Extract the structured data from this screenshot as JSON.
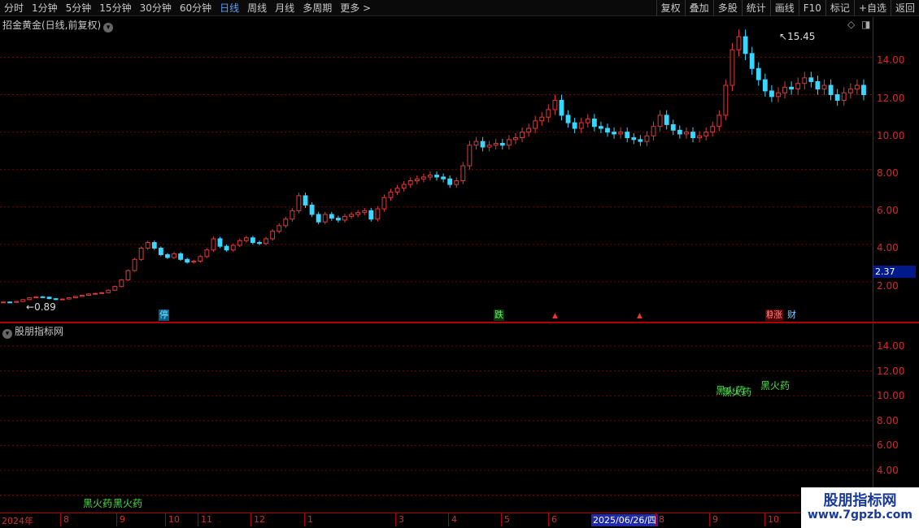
{
  "toolbar": {
    "periods": [
      "分时",
      "1分钟",
      "5分钟",
      "15分钟",
      "30分钟",
      "60分钟",
      "日线",
      "周线",
      "月线",
      "多周期",
      "更多"
    ],
    "active_period": "日线",
    "right_buttons": [
      "复权",
      "叠加",
      "多股",
      "统计",
      "画线",
      "F10",
      "标记",
      "+自选",
      "返回"
    ]
  },
  "main": {
    "title": "招金黄金(日线,前复权)",
    "title_icon": "chevron-down-icon",
    "corner_icons": [
      "diamond-icon",
      "panel-toggle-icon"
    ],
    "y_labels": [
      "14.00",
      "12.00",
      "10.00",
      "8.00",
      "6.00",
      "4.00",
      "2.00"
    ],
    "current_price_tag": "2.37",
    "high_label": "15.45",
    "low_label": "0.89",
    "badges": [
      {
        "text": "停",
        "style": "blue"
      },
      {
        "text": "跌",
        "style": "green"
      },
      {
        "text": "糕",
        "style": "red"
      },
      {
        "text": "涨",
        "style": "red"
      },
      {
        "text": "财",
        "style": "plain"
      }
    ]
  },
  "sub": {
    "title": "股朋指标网",
    "title_icon": "chevron-down-icon",
    "y_labels": [
      "14.00",
      "12.00",
      "10.00",
      "8.00",
      "6.00",
      "4.00"
    ],
    "notes": [
      "黑火药",
      "黑火药",
      "黑火药",
      "黑火药",
      "黑火药"
    ]
  },
  "timeline": {
    "labels": [
      "2024年",
      "8",
      "9",
      "10",
      "11",
      "12",
      "1",
      "3",
      "4",
      "5",
      "6",
      "8",
      "9",
      "10"
    ],
    "cursor_date": "2025/06/26/四"
  },
  "watermark": {
    "line1": "股朋指标网",
    "line2": "www.7gpzb.com"
  },
  "colors": {
    "up": "#e03a3a",
    "down": "#3ad6ff",
    "grid": "#7a0000",
    "axis": "#b00000",
    "note": "#4ce04c",
    "active": "#5aa0ff"
  },
  "chart_data": {
    "type": "candlestick",
    "title": "招金黄金(日线,前复权)",
    "ylim": [
      0,
      15.8
    ],
    "x_range": [
      "2024年",
      "2025/10"
    ],
    "close_series": [
      0.92,
      0.9,
      0.95,
      1.05,
      1.15,
      1.2,
      1.18,
      1.1,
      1.05,
      1.08,
      1.15,
      1.22,
      1.28,
      1.35,
      1.38,
      1.42,
      1.55,
      1.75,
      2.1,
      2.6,
      3.2,
      3.8,
      4.1,
      3.8,
      3.45,
      3.3,
      3.5,
      3.2,
      3.05,
      3.1,
      3.35,
      3.7,
      4.3,
      3.9,
      3.7,
      3.95,
      4.2,
      4.35,
      4.1,
      4.05,
      4.3,
      4.7,
      5.0,
      5.35,
      5.8,
      6.6,
      6.1,
      5.6,
      5.2,
      5.6,
      5.4,
      5.3,
      5.5,
      5.6,
      5.7,
      5.8,
      5.35,
      5.9,
      6.5,
      6.8,
      7.0,
      7.2,
      7.4,
      7.5,
      7.6,
      7.7,
      7.6,
      7.5,
      7.2,
      7.4,
      8.2,
      9.3,
      9.5,
      9.2,
      9.3,
      9.4,
      9.3,
      9.6,
      9.7,
      10.0,
      10.2,
      10.6,
      10.8,
      11.2,
      11.7,
      10.9,
      10.5,
      10.2,
      10.5,
      10.7,
      10.3,
      10.2,
      10.0,
      9.9,
      10.0,
      9.7,
      9.6,
      9.5,
      9.8,
      10.3,
      10.9,
      10.4,
      10.1,
      9.9,
      10.0,
      9.7,
      9.8,
      10.0,
      10.3,
      10.9,
      12.5,
      14.4,
      15.1,
      14.2,
      13.4,
      12.8,
      12.2,
      11.9,
      12.1,
      12.4,
      12.3,
      12.6,
      12.9,
      12.7,
      12.3,
      12.5,
      12.0,
      11.7,
      12.1,
      12.3,
      12.5,
      12.0
    ]
  }
}
